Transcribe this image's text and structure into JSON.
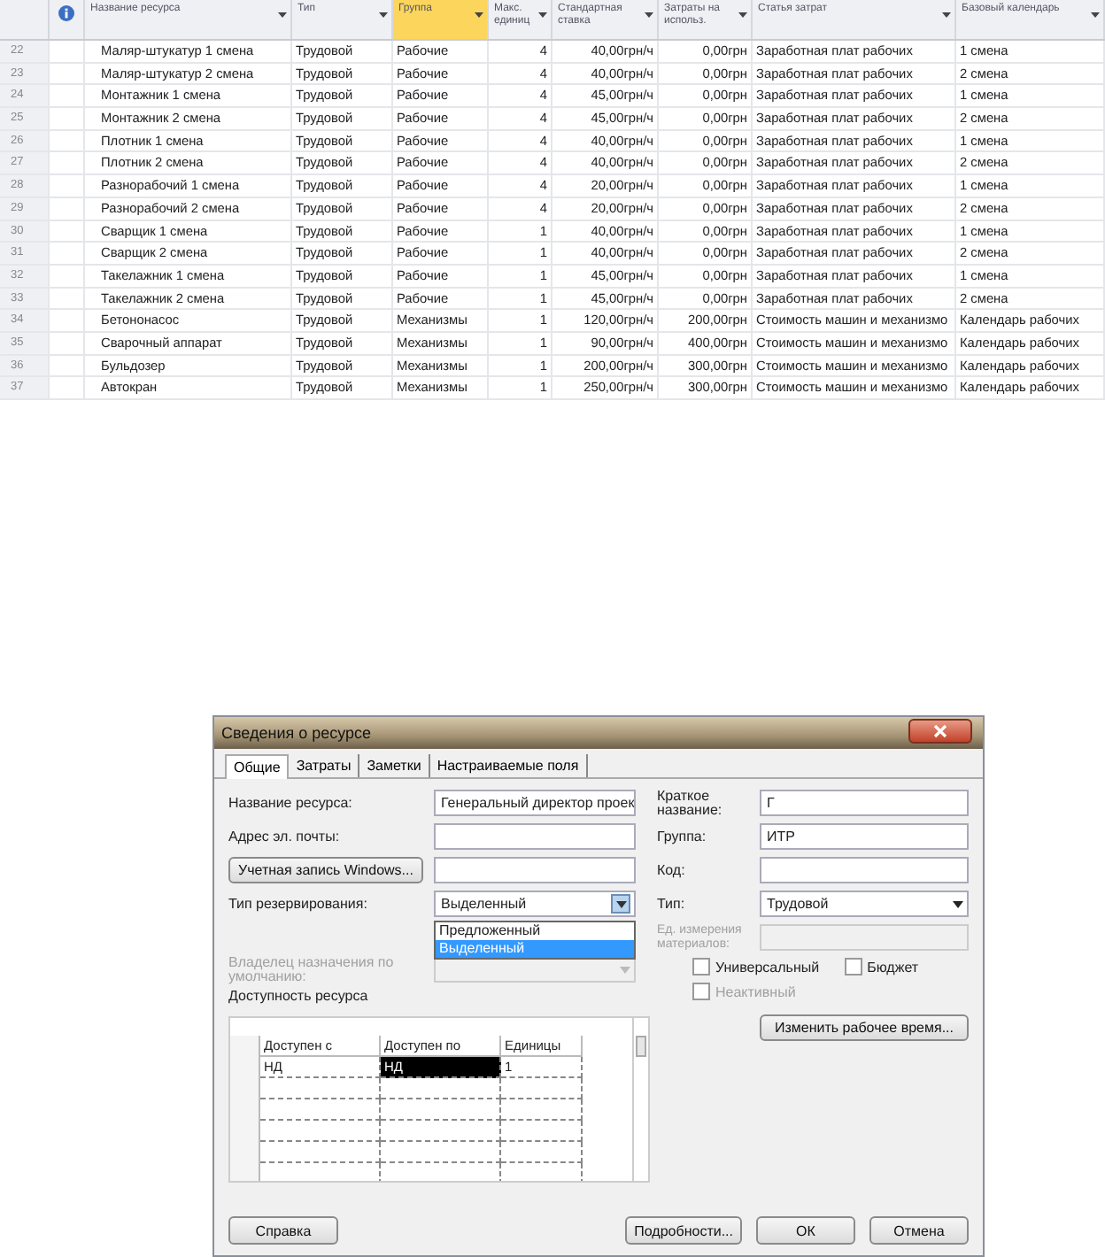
{
  "table": {
    "columns": [
      {
        "kind": "num",
        "selected": false
      },
      {
        "kind": "info",
        "selected": false
      },
      {
        "label": "Название ресурса",
        "kind": "text",
        "selected": false
      },
      {
        "label": "Тип",
        "kind": "text",
        "selected": false
      },
      {
        "label": "Группа",
        "kind": "text",
        "selected": true
      },
      {
        "label": "Макс. единиц",
        "kind": "right",
        "selected": false
      },
      {
        "label": "Стандартная ставка",
        "kind": "right",
        "selected": false
      },
      {
        "label": "Затраты на использ.",
        "kind": "right",
        "selected": false
      },
      {
        "label": "Статья затрат",
        "kind": "text",
        "selected": false
      },
      {
        "label": "Базовый календарь",
        "kind": "text",
        "selected": false
      }
    ],
    "rows": [
      [
        "22",
        "",
        "Маляр-штукатур 1 смена",
        "Трудовой",
        "Рабочие",
        "4",
        "40,00грн/ч",
        "0,00грн",
        "Заработная плат рабочих",
        "1 смена"
      ],
      [
        "23",
        "",
        "Маляр-штукатур 2 смена",
        "Трудовой",
        "Рабочие",
        "4",
        "40,00грн/ч",
        "0,00грн",
        "Заработная плат рабочих",
        "2 смена"
      ],
      [
        "24",
        "",
        "Монтажник 1 смена",
        "Трудовой",
        "Рабочие",
        "4",
        "45,00грн/ч",
        "0,00грн",
        "Заработная плат рабочих",
        "1 смена"
      ],
      [
        "25",
        "",
        "Монтажник 2 смена",
        "Трудовой",
        "Рабочие",
        "4",
        "45,00грн/ч",
        "0,00грн",
        "Заработная плат рабочих",
        "2 смена"
      ],
      [
        "26",
        "",
        "Плотник 1 смена",
        "Трудовой",
        "Рабочие",
        "4",
        "40,00грн/ч",
        "0,00грн",
        "Заработная плат рабочих",
        "1 смена"
      ],
      [
        "27",
        "",
        "Плотник 2 смена",
        "Трудовой",
        "Рабочие",
        "4",
        "40,00грн/ч",
        "0,00грн",
        "Заработная плат рабочих",
        "2 смена"
      ],
      [
        "28",
        "",
        "Разнорабочий 1 смена",
        "Трудовой",
        "Рабочие",
        "4",
        "20,00грн/ч",
        "0,00грн",
        "Заработная плат рабочих",
        "1 смена"
      ],
      [
        "29",
        "",
        "Разнорабочий 2 смена",
        "Трудовой",
        "Рабочие",
        "4",
        "20,00грн/ч",
        "0,00грн",
        "Заработная плат рабочих",
        "2 смена"
      ],
      [
        "30",
        "",
        "Сварщик 1 смена",
        "Трудовой",
        "Рабочие",
        "1",
        "40,00грн/ч",
        "0,00грн",
        "Заработная плат рабочих",
        "1 смена"
      ],
      [
        "31",
        "",
        "Сварщик 2 смена",
        "Трудовой",
        "Рабочие",
        "1",
        "40,00грн/ч",
        "0,00грн",
        "Заработная плат рабочих",
        "2 смена"
      ],
      [
        "32",
        "",
        "Такелажник 1 смена",
        "Трудовой",
        "Рабочие",
        "1",
        "45,00грн/ч",
        "0,00грн",
        "Заработная плат рабочих",
        "1 смена"
      ],
      [
        "33",
        "",
        "Такелажник 2 смена",
        "Трудовой",
        "Рабочие",
        "1",
        "45,00грн/ч",
        "0,00грн",
        "Заработная плат рабочих",
        "2 смена"
      ],
      [
        "34",
        "",
        "Бетононасос",
        "Трудовой",
        "Механизмы",
        "1",
        "120,00грн/ч",
        "200,00грн",
        "Стоимость машин и механизмо",
        "Календарь рабочих"
      ],
      [
        "35",
        "",
        "Сварочный аппарат",
        "Трудовой",
        "Механизмы",
        "1",
        "90,00грн/ч",
        "400,00грн",
        "Стоимость машин и механизмо",
        "Календарь рабочих"
      ],
      [
        "36",
        "",
        "Бульдозер",
        "Трудовой",
        "Механизмы",
        "1",
        "200,00грн/ч",
        "300,00грн",
        "Стоимость машин и механизмо",
        "Календарь рабочих"
      ],
      [
        "37",
        "",
        "Автокран",
        "Трудовой",
        "Механизмы",
        "1",
        "250,00грн/ч",
        "300,00грн",
        "Стоимость машин и механизмо",
        "Календарь рабочих"
      ]
    ]
  },
  "dialog": {
    "title": "Сведения о ресурсе",
    "tabs": [
      {
        "label": "Общие",
        "selected": true
      },
      {
        "label": "Затраты",
        "selected": false
      },
      {
        "label": "Заметки",
        "selected": false
      },
      {
        "label": "Настраиваемые поля",
        "selected": false
      }
    ],
    "resource_name": {
      "label": "Название ресурса:",
      "value": "Генеральный директор проек"
    },
    "email": {
      "label": "Адрес эл. почты:"
    },
    "windows_account_button": "Учетная запись Windows...",
    "booking_type": {
      "label": "Тип резервирования:",
      "value": "Выделенный",
      "options": [
        {
          "label": "Предложенный",
          "selected": false
        },
        {
          "label": "Выделенный",
          "selected": true
        }
      ]
    },
    "default_owner": {
      "label": "Владелец назначения по умолчанию:",
      "disabled": true
    },
    "availability": {
      "label": "Доступность ресурса",
      "columns": [
        "Доступен с",
        "Доступен по",
        "Единицы"
      ],
      "rows": [
        [
          {
            "text": "НД",
            "selected": false
          },
          {
            "text": "НД",
            "selected": true
          },
          {
            "text": "1",
            "selected": false
          }
        ]
      ]
    },
    "short_name": {
      "label": "Краткое название:",
      "value": "Г"
    },
    "group": {
      "label": "Группа:",
      "value": "ИТР"
    },
    "code": {
      "label": "Код:"
    },
    "type": {
      "label": "Тип:",
      "value": "Трудовой"
    },
    "material_units": {
      "label": "Ед. измерения материалов:",
      "disabled": true
    },
    "checkboxes": [
      {
        "label": "Универсальный",
        "checked": false,
        "disabled": false
      },
      {
        "label": "Бюджет",
        "checked": false,
        "disabled": false
      },
      {
        "label": "Неактивный",
        "checked": false,
        "disabled": true
      }
    ],
    "change_time_button": "Изменить рабочее время...",
    "buttons": [
      {
        "label": "Справка",
        "kind": "left"
      },
      {
        "label": "Подробности...",
        "kind": "right"
      },
      {
        "label": "ОК",
        "kind": "right"
      },
      {
        "label": "Отмена",
        "kind": "right"
      }
    ]
  }
}
